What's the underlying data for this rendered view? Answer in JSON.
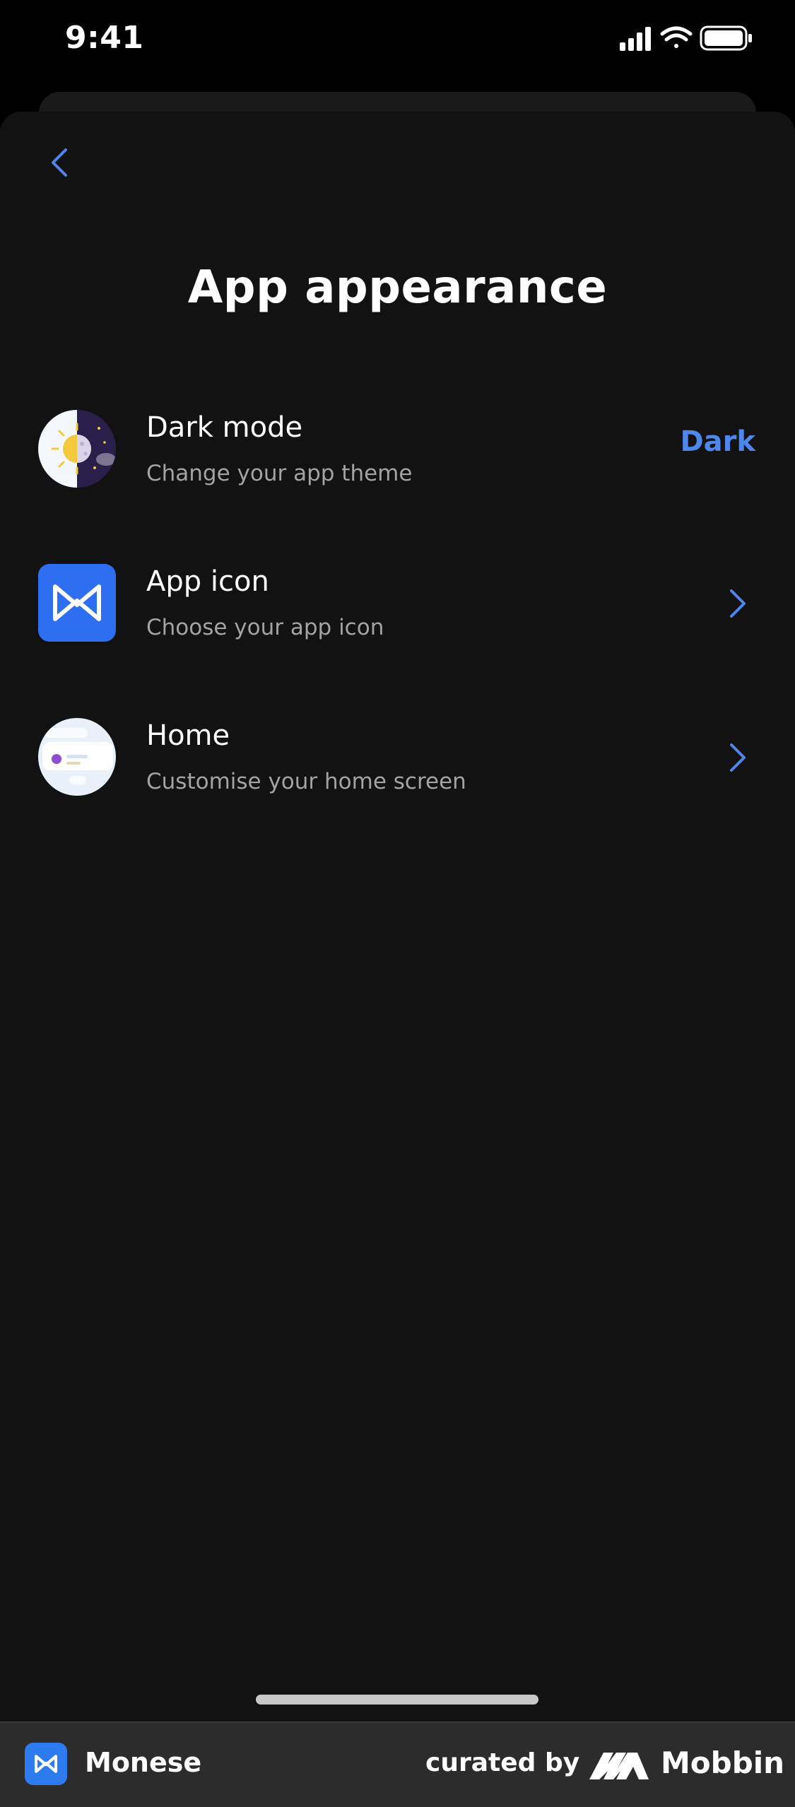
{
  "status_bar": {
    "time": "9:41"
  },
  "header": {
    "title": "App appearance"
  },
  "rows": [
    {
      "title": "Dark mode",
      "subtitle": "Change your app theme",
      "value": "Dark"
    },
    {
      "title": "App icon",
      "subtitle": "Choose your app icon"
    },
    {
      "title": "Home",
      "subtitle": "Customise your home screen"
    }
  ],
  "footer": {
    "brand": "Monese",
    "curated_by": "curated by",
    "curator": "Mobbin"
  },
  "colors": {
    "accent": "#4f86ec",
    "background": "#121212",
    "app_icon_blue": "#2e6ff2"
  },
  "icons": {
    "back": "chevron-left-icon",
    "chevron": "chevron-right-icon",
    "dark_mode": "sun-moon-icon",
    "app_icon": "monese-logo-icon",
    "home": "home-screen-preview-icon"
  }
}
